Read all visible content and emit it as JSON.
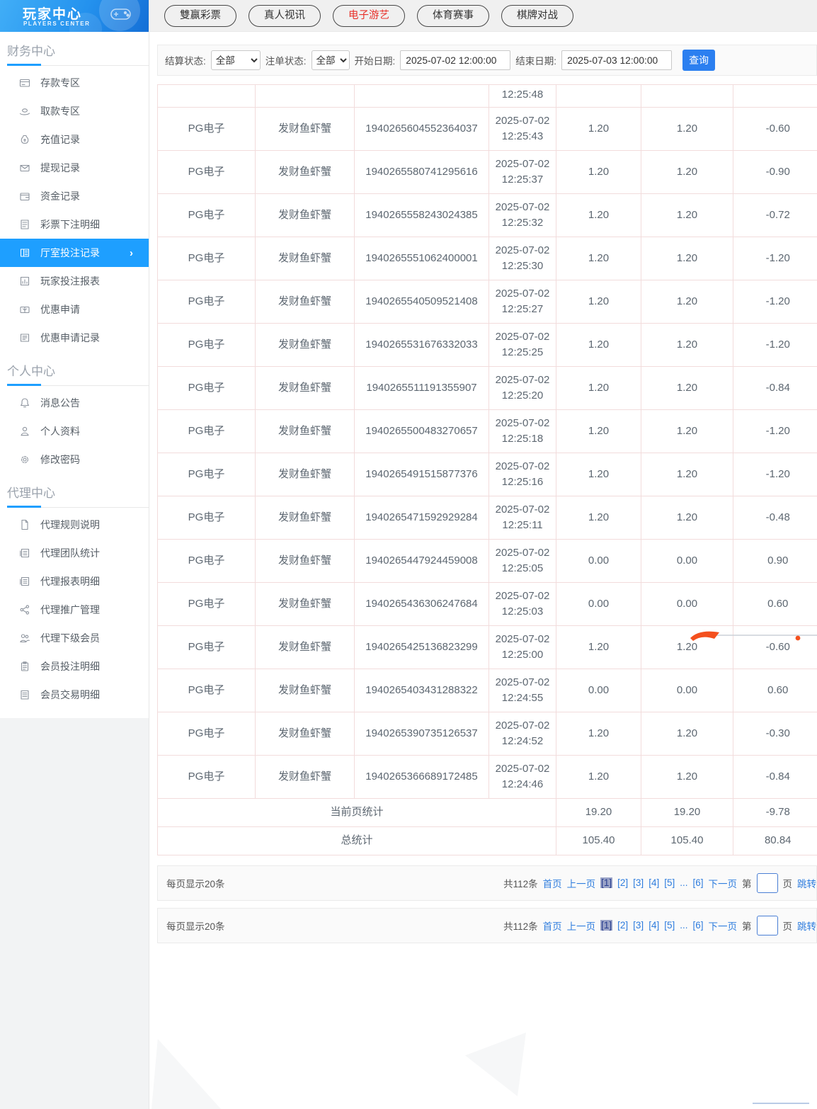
{
  "sidebar": {
    "logo": {
      "title": "玩家中心",
      "subtitle": "PLAYERS CENTER"
    },
    "sections": [
      {
        "title": "财务中心",
        "items": [
          {
            "label": "存款专区",
            "icon": "deposit-icon"
          },
          {
            "label": "取款专区",
            "icon": "withdraw-icon"
          },
          {
            "label": "充值记录",
            "icon": "recharge-record-icon"
          },
          {
            "label": "提现记录",
            "icon": "withdraw-record-icon"
          },
          {
            "label": "资金记录",
            "icon": "funds-record-icon"
          },
          {
            "label": "彩票下注明细",
            "icon": "lottery-detail-icon"
          },
          {
            "label": "厅室投注记录",
            "icon": "hall-bet-record-icon",
            "active": true
          },
          {
            "label": "玩家投注报表",
            "icon": "player-report-icon"
          },
          {
            "label": "优惠申请",
            "icon": "promo-apply-icon"
          },
          {
            "label": "优惠申请记录",
            "icon": "promo-record-icon"
          }
        ]
      },
      {
        "title": "个人中心",
        "items": [
          {
            "label": "消息公告",
            "icon": "bell-icon"
          },
          {
            "label": "个人资料",
            "icon": "user-icon"
          },
          {
            "label": "修改密码",
            "icon": "gear-icon"
          }
        ]
      },
      {
        "title": "代理中心",
        "items": [
          {
            "label": "代理规则说明",
            "icon": "doc-icon"
          },
          {
            "label": "代理团队统计",
            "icon": "team-stats-icon"
          },
          {
            "label": "代理报表明细",
            "icon": "report-detail-icon"
          },
          {
            "label": "代理推广管理",
            "icon": "share-icon"
          },
          {
            "label": "代理下级会员",
            "icon": "members-icon"
          },
          {
            "label": "会员投注明细",
            "icon": "member-bet-icon"
          },
          {
            "label": "会员交易明细",
            "icon": "member-trans-icon"
          }
        ]
      }
    ]
  },
  "tabs": [
    {
      "label": "雙赢彩票",
      "active": false
    },
    {
      "label": "真人视讯",
      "active": false
    },
    {
      "label": "电子游艺",
      "active": true
    },
    {
      "label": "体育赛事",
      "active": false
    },
    {
      "label": "棋牌对战",
      "active": false
    }
  ],
  "filters": {
    "settle_status_label": "结算状态:",
    "settle_status_value": "全部",
    "order_status_label": "注单状态:",
    "order_status_value": "全部",
    "start_date_label": "开始日期:",
    "start_date_value": "2025-07-02 12:00:00",
    "end_date_label": "结束日期:",
    "end_date_value": "2025-07-03 12:00:00",
    "query_label": "查询"
  },
  "table": {
    "partial_row_time": "12:25:48",
    "rows": [
      {
        "vendor": "PG电子",
        "game": "发财鱼虾蟹",
        "order": "1940265604552364037",
        "date": "2025-07-02",
        "time": "12:25:43",
        "bet": "1.20",
        "valid": "1.20",
        "profit": "-0.60"
      },
      {
        "vendor": "PG电子",
        "game": "发财鱼虾蟹",
        "order": "1940265580741295616",
        "date": "2025-07-02",
        "time": "12:25:37",
        "bet": "1.20",
        "valid": "1.20",
        "profit": "-0.90"
      },
      {
        "vendor": "PG电子",
        "game": "发财鱼虾蟹",
        "order": "1940265558243024385",
        "date": "2025-07-02",
        "time": "12:25:32",
        "bet": "1.20",
        "valid": "1.20",
        "profit": "-0.72"
      },
      {
        "vendor": "PG电子",
        "game": "发财鱼虾蟹",
        "order": "1940265551062400001",
        "date": "2025-07-02",
        "time": "12:25:30",
        "bet": "1.20",
        "valid": "1.20",
        "profit": "-1.20"
      },
      {
        "vendor": "PG电子",
        "game": "发财鱼虾蟹",
        "order": "1940265540509521408",
        "date": "2025-07-02",
        "time": "12:25:27",
        "bet": "1.20",
        "valid": "1.20",
        "profit": "-1.20"
      },
      {
        "vendor": "PG电子",
        "game": "发财鱼虾蟹",
        "order": "1940265531676332033",
        "date": "2025-07-02",
        "time": "12:25:25",
        "bet": "1.20",
        "valid": "1.20",
        "profit": "-1.20"
      },
      {
        "vendor": "PG电子",
        "game": "发财鱼虾蟹",
        "order": "1940265511191355907",
        "date": "2025-07-02",
        "time": "12:25:20",
        "bet": "1.20",
        "valid": "1.20",
        "profit": "-0.84"
      },
      {
        "vendor": "PG电子",
        "game": "发财鱼虾蟹",
        "order": "1940265500483270657",
        "date": "2025-07-02",
        "time": "12:25:18",
        "bet": "1.20",
        "valid": "1.20",
        "profit": "-1.20"
      },
      {
        "vendor": "PG电子",
        "game": "发财鱼虾蟹",
        "order": "1940265491515877376",
        "date": "2025-07-02",
        "time": "12:25:16",
        "bet": "1.20",
        "valid": "1.20",
        "profit": "-1.20"
      },
      {
        "vendor": "PG电子",
        "game": "发财鱼虾蟹",
        "order": "1940265471592929284",
        "date": "2025-07-02",
        "time": "12:25:11",
        "bet": "1.20",
        "valid": "1.20",
        "profit": "-0.48"
      },
      {
        "vendor": "PG电子",
        "game": "发财鱼虾蟹",
        "order": "1940265447924459008",
        "date": "2025-07-02",
        "time": "12:25:05",
        "bet": "0.00",
        "valid": "0.00",
        "profit": "0.90"
      },
      {
        "vendor": "PG电子",
        "game": "发财鱼虾蟹",
        "order": "1940265436306247684",
        "date": "2025-07-02",
        "time": "12:25:03",
        "bet": "0.00",
        "valid": "0.00",
        "profit": "0.60"
      },
      {
        "vendor": "PG电子",
        "game": "发财鱼虾蟹",
        "order": "1940265425136823299",
        "date": "2025-07-02",
        "time": "12:25:00",
        "bet": "1.20",
        "valid": "1.20",
        "profit": "-0.60"
      },
      {
        "vendor": "PG电子",
        "game": "发财鱼虾蟹",
        "order": "1940265403431288322",
        "date": "2025-07-02",
        "time": "12:24:55",
        "bet": "0.00",
        "valid": "0.00",
        "profit": "0.60"
      },
      {
        "vendor": "PG电子",
        "game": "发财鱼虾蟹",
        "order": "1940265390735126537",
        "date": "2025-07-02",
        "time": "12:24:52",
        "bet": "1.20",
        "valid": "1.20",
        "profit": "-0.30"
      },
      {
        "vendor": "PG电子",
        "game": "发财鱼虾蟹",
        "order": "1940265366689172485",
        "date": "2025-07-02",
        "time": "12:24:46",
        "bet": "1.20",
        "valid": "1.20",
        "profit": "-0.84"
      }
    ],
    "page_total_label": "当前页统计",
    "page_total": [
      "19.20",
      "19.20",
      "-9.78"
    ],
    "grand_total_label": "总统计",
    "grand_total": [
      "105.40",
      "105.40",
      "80.84"
    ]
  },
  "pagination": {
    "per_page": "每页显示20条",
    "total": "共112条",
    "first": "首页",
    "prev": "上一页",
    "pages": [
      {
        "label": "[1]",
        "current": true
      },
      {
        "label": "[2]",
        "current": false
      },
      {
        "label": "[3]",
        "current": false
      },
      {
        "label": "[4]",
        "current": false
      },
      {
        "label": "[5]",
        "current": false
      },
      {
        "label": "...",
        "current": false,
        "ellipsis": true
      },
      {
        "label": "[6]",
        "current": false
      }
    ],
    "next": "下一页",
    "jump_prefix": "第",
    "jump_suffix": "页",
    "jump_label": "跳转"
  },
  "colors": {
    "accent_blue": "#1e9fff",
    "query_button_blue": "#2b7ff0",
    "active_tab_red": "#e8312a",
    "link_blue": "#2f7dde",
    "table_border_pink": "#f2dcdc",
    "page_current_highlight": "#9aa3c7",
    "annotation_orange": "#f4501e"
  }
}
